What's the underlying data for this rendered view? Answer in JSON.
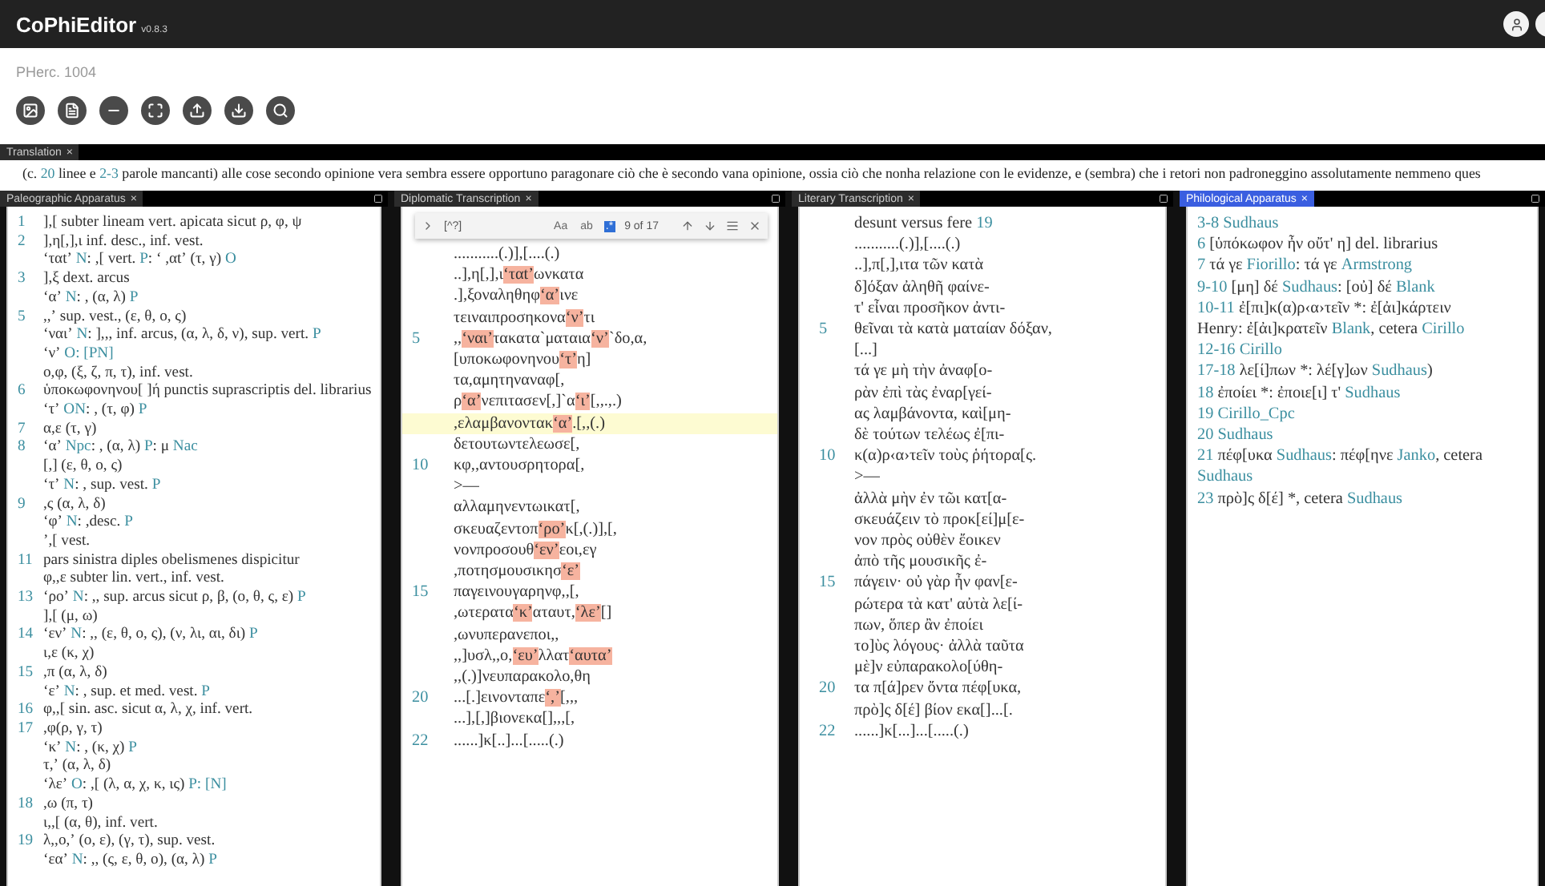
{
  "app": {
    "title": "CoPhiEditor",
    "version": "v0.8.3"
  },
  "document": {
    "title": "PHerc. 1004"
  },
  "toolbar": [
    {
      "kind": "image"
    },
    {
      "kind": "document"
    },
    {
      "kind": "minus"
    },
    {
      "kind": "expand"
    },
    {
      "kind": "upload"
    },
    {
      "kind": "download"
    },
    {
      "kind": "search"
    }
  ],
  "translation": {
    "tab": "Translation",
    "close": "×",
    "parts": [
      {
        "text": "(c. ",
        "kind": "plain"
      },
      {
        "text": "20",
        "kind": "siglum"
      },
      {
        "text": " linee e ",
        "kind": "plain"
      },
      {
        "text": "2-3",
        "kind": "siglum"
      },
      {
        "text": " parole mancanti) alle cose secondo opinione vera sembra essere opportuno paragonare ciò che è secondo vana opinione, ossia ciò che nonha relazione con le evidenze, e (sembra) che i retori non padroneggino assolutamente nemmeno ques",
        "kind": "plain"
      }
    ]
  },
  "panels": [
    {
      "kind": "apparatus",
      "tab": "Paleographic Apparatus",
      "close": "×",
      "selected": false,
      "lines": [
        {
          "num": "1",
          "text": "],[ subter lineam vert. apicata sicut ρ, φ, ψ"
        },
        {
          "num": "2",
          "text": "],η[,],ι inf. desc., inf. vest."
        },
        {
          "parts": [
            {
              "text": "ʻταtʼ ",
              "kind": "plain"
            },
            {
              "text": "N",
              "kind": "siglum"
            },
            {
              "text": ": ,[ vert. ",
              "kind": "plain"
            },
            {
              "text": "P",
              "kind": "siglum"
            },
            {
              "text": ": ʻ ,αtʼ (τ, γ) ",
              "kind": "plain"
            },
            {
              "text": "O",
              "kind": "siglum"
            }
          ]
        },
        {
          "num": "3",
          "text": "],ξ dext. arcus"
        },
        {
          "parts": [
            {
              "text": "ʻαʼ ",
              "kind": "plain"
            },
            {
              "text": "N",
              "kind": "siglum"
            },
            {
              "text": ": , (α, λ) ",
              "kind": "plain"
            },
            {
              "text": "P",
              "kind": "siglum"
            }
          ]
        },
        {
          "num": "5",
          "text": ",,ʼ sup. vest., (ε, θ, ο, ς)"
        },
        {
          "parts": [
            {
              "text": "ʻναιʼ ",
              "kind": "plain"
            },
            {
              "text": "N",
              "kind": "siglum"
            },
            {
              "text": ": ],,, inf. arcus, (α, λ, δ, ν), sup. vert. ",
              "kind": "plain"
            },
            {
              "text": "P",
              "kind": "siglum"
            }
          ]
        },
        {
          "parts": [
            {
              "text": "ʻνʼ ",
              "kind": "plain"
            },
            {
              "text": "O: [PN]",
              "kind": "siglum"
            }
          ]
        },
        {
          "text": "ο,φ, (ξ, ζ, π, τ), inf. vest."
        },
        {
          "num": "6",
          "text": "ὑποκωφονηνου[ ]ή punctis suprascriptis del. librarius"
        },
        {
          "parts": [
            {
              "text": "ʻτʼ ",
              "kind": "plain"
            },
            {
              "text": "ON",
              "kind": "siglum"
            },
            {
              "text": ": , (τ, φ) ",
              "kind": "plain"
            },
            {
              "text": "P",
              "kind": "siglum"
            }
          ]
        },
        {
          "num": "7",
          "text": "α,ε (τ, γ)"
        },
        {
          "num": "8",
          "parts": [
            {
              "text": "ʻαʼ ",
              "kind": "plain"
            },
            {
              "text": "Npc",
              "kind": "siglum"
            },
            {
              "text": ": , (α, λ) ",
              "kind": "plain"
            },
            {
              "text": "P",
              "kind": "siglum"
            },
            {
              "text": ": μ ",
              "kind": "plain"
            },
            {
              "text": "Nac",
              "kind": "siglum"
            }
          ]
        },
        {
          "text": "[,] (ε, θ, ο, ς)"
        },
        {
          "parts": [
            {
              "text": "ʻτʼ ",
              "kind": "plain"
            },
            {
              "text": "N",
              "kind": "siglum"
            },
            {
              "text": ": , sup. vest. ",
              "kind": "plain"
            },
            {
              "text": "P",
              "kind": "siglum"
            }
          ]
        },
        {
          "num": "9",
          "text": ",ς (α, λ, δ)"
        },
        {
          "parts": [
            {
              "text": "ʻφʼ ",
              "kind": "plain"
            },
            {
              "text": "N",
              "kind": "siglum"
            },
            {
              "text": ": ,desc. ",
              "kind": "plain"
            },
            {
              "text": "P",
              "kind": "siglum"
            }
          ]
        },
        {
          "text": "ʼ,[ vest."
        },
        {
          "num": "11",
          "text": "pars sinistra diples obelismenes dispicitur"
        },
        {
          "text": "φ,,ε subter lin. vert., inf. vest."
        },
        {
          "num": "13",
          "parts": [
            {
              "text": "ʻροʼ ",
              "kind": "plain"
            },
            {
              "text": "N",
              "kind": "siglum"
            },
            {
              "text": ": ,, sup. arcus sicut ρ, β, (ο, θ, ς, ε) ",
              "kind": "plain"
            },
            {
              "text": "P",
              "kind": "siglum"
            }
          ]
        },
        {
          "text": "],[ (μ, ω)"
        },
        {
          "num": "14",
          "parts": [
            {
              "text": "ʻενʼ ",
              "kind": "plain"
            },
            {
              "text": "N",
              "kind": "siglum"
            },
            {
              "text": ": ,, (ε, θ, ο, ς), (ν, λι, αι, δι) ",
              "kind": "plain"
            },
            {
              "text": "P",
              "kind": "siglum"
            }
          ]
        },
        {
          "text": "ι,ε (κ, χ)"
        },
        {
          "num": "15",
          "text": ",π (α, λ, δ)"
        },
        {
          "parts": [
            {
              "text": "ʻεʼ ",
              "kind": "plain"
            },
            {
              "text": "N",
              "kind": "siglum"
            },
            {
              "text": ": , sup. et med. vest. ",
              "kind": "plain"
            },
            {
              "text": "P",
              "kind": "siglum"
            }
          ]
        },
        {
          "num": "16",
          "text": "φ,,[ sin. asc. sicut α, λ, χ, inf. vert."
        },
        {
          "num": "17",
          "text": ",φ(ρ, γ, τ)"
        },
        {
          "parts": [
            {
              "text": "ʻκʼ ",
              "kind": "plain"
            },
            {
              "text": "N",
              "kind": "siglum"
            },
            {
              "text": ": , (κ, χ) ",
              "kind": "plain"
            },
            {
              "text": "P",
              "kind": "siglum"
            }
          ]
        },
        {
          "text": "τ,ʼ (α, λ, δ)"
        },
        {
          "parts": [
            {
              "text": "ʻλεʼ ",
              "kind": "plain"
            },
            {
              "text": "O",
              "kind": "siglum"
            },
            {
              "text": ": ,[ (λ, α, χ, κ, ις) ",
              "kind": "plain"
            },
            {
              "text": "P: [N]",
              "kind": "siglum"
            }
          ]
        },
        {
          "num": "18",
          "text": ",ω (π, τ)"
        },
        {
          "text": "ι,,[ (α, θ), inf. vert."
        },
        {
          "num": "19",
          "text": "λ,,ο,ʼ (ο, ε), (γ, τ), sup. vest."
        },
        {
          "parts": [
            {
              "text": "ʻεαʼ ",
              "kind": "plain"
            },
            {
              "text": "N",
              "kind": "siglum"
            },
            {
              "text": ": ,, (ς, ε, θ, ο), (α, λ) ",
              "kind": "plain"
            },
            {
              "text": "P",
              "kind": "siglum"
            }
          ]
        }
      ]
    },
    {
      "kind": "diplomatic",
      "tab": "Diplomatic Transcription",
      "close": "×",
      "selected": false,
      "find": {
        "query": "[^?]",
        "options": [
          {
            "label": "Aa",
            "selected": false
          },
          {
            "label": "ab",
            "selected": false
          },
          {
            "label": ".*",
            "selected": true
          }
        ],
        "count": "9 of 17"
      },
      "lines": [
        {
          "current": false,
          "text": "...........(.)],[....(.)"
        },
        {
          "current": false,
          "parts": [
            {
              "text": "..],η[,],ι",
              "kind": "plain"
            },
            {
              "text": "ʻταtʼ",
              "kind": "mark"
            },
            {
              "text": "ωνκατα",
              "kind": "plain"
            }
          ]
        },
        {
          "current": false,
          "parts": [
            {
              "text": ".],ξοναληθηφ",
              "kind": "plain"
            },
            {
              "text": "ʻαʼ",
              "kind": "mark"
            },
            {
              "text": "ινε",
              "kind": "plain"
            }
          ]
        },
        {
          "current": false,
          "parts": [
            {
              "text": "τειναιπροσηκονα",
              "kind": "plain"
            },
            {
              "text": "ʻνʼ",
              "kind": "mark"
            },
            {
              "text": "τι",
              "kind": "plain"
            }
          ]
        },
        {
          "current": false,
          "num": "5",
          "parts": [
            {
              "text": ",,",
              "kind": "plain"
            },
            {
              "text": "ʻναιʼ",
              "kind": "mark"
            },
            {
              "text": "τακατα`ματαια",
              "kind": "plain"
            },
            {
              "text": "ʻνʼ",
              "kind": "mark"
            },
            {
              "text": "`δο,α,",
              "kind": "plain"
            }
          ]
        },
        {
          "current": false,
          "parts": [
            {
              "text": "[υποκωφονηνου",
              "kind": "plain"
            },
            {
              "text": "ʻτʼ",
              "kind": "mark"
            },
            {
              "text": "η]",
              "kind": "plain"
            }
          ]
        },
        {
          "current": false,
          "text": "τα,αμητηναναφ[,"
        },
        {
          "current": false,
          "parts": [
            {
              "text": "ρ",
              "kind": "plain"
            },
            {
              "text": "ʻαʼ",
              "kind": "mark"
            },
            {
              "text": "νεπιτασεν[,]`α",
              "kind": "plain"
            },
            {
              "text": "ʻιʼ",
              "kind": "mark"
            },
            {
              "text": "[,,.,.)",
              "kind": "plain"
            }
          ]
        },
        {
          "current": true,
          "parts": [
            {
              "text": ",ελαμβανοντακ",
              "kind": "plain"
            },
            {
              "text": "ʻαʼ",
              "kind": "mark"
            },
            {
              "text": ".[,,(.)",
              "kind": "plain"
            }
          ]
        },
        {
          "current": false,
          "text": "δετουτωντελεωσε[,"
        },
        {
          "current": false,
          "num": "10",
          "text": "κφ,,αντουσρητορα[,"
        },
        {
          "current": false,
          "text": ">—"
        },
        {
          "current": false,
          "text": "αλλαμηνεντωικατ[,"
        },
        {
          "current": false,
          "parts": [
            {
              "text": "σκευαζεντοπ",
              "kind": "plain"
            },
            {
              "text": "ʻροʼ",
              "kind": "mark"
            },
            {
              "text": "κ[,(.)],[,",
              "kind": "plain"
            }
          ]
        },
        {
          "current": false,
          "parts": [
            {
              "text": "νονπροσουθ",
              "kind": "plain"
            },
            {
              "text": "ʻενʼ",
              "kind": "mark"
            },
            {
              "text": "εοι,εγ",
              "kind": "plain"
            }
          ]
        },
        {
          "current": false,
          "parts": [
            {
              "text": ",ποτησμουσικησ",
              "kind": "plain"
            },
            {
              "text": "ʻεʼ",
              "kind": "mark"
            }
          ]
        },
        {
          "current": false,
          "num": "15",
          "text": "παγεινουγαρηνφ,,[,"
        },
        {
          "current": false,
          "parts": [
            {
              "text": ",ωτερατα",
              "kind": "plain"
            },
            {
              "text": "ʻκʼ",
              "kind": "mark"
            },
            {
              "text": "αταυτ,",
              "kind": "plain"
            },
            {
              "text": "ʻλεʼ",
              "kind": "mark"
            },
            {
              "text": "[]",
              "kind": "plain"
            }
          ]
        },
        {
          "current": false,
          "text": ",ωνυπερανεποι,,"
        },
        {
          "current": false,
          "parts": [
            {
              "text": ",,]υσλ,,ο,",
              "kind": "plain"
            },
            {
              "text": "ʻευʼ",
              "kind": "mark"
            },
            {
              "text": "λλατ",
              "kind": "plain"
            },
            {
              "text": "ʻαυταʼ",
              "kind": "mark"
            }
          ]
        },
        {
          "current": false,
          "text": ",,(.)]νευπαρακολο,θη"
        },
        {
          "current": false,
          "num": "20",
          "parts": [
            {
              "text": "...[.]εινονταπε",
              "kind": "plain"
            },
            {
              "text": "ʻ,ʼ",
              "kind": "mark"
            },
            {
              "text": "[,,,",
              "kind": "plain"
            }
          ]
        },
        {
          "current": false,
          "text": "...],[,]βιονεκα[],,,[,"
        },
        {
          "current": false,
          "num": "22",
          "text": "......]κ[..]...[.....(.)"
        }
      ]
    },
    {
      "kind": "literary",
      "tab": "Literary Transcription",
      "close": "×",
      "selected": false,
      "lines": [
        {
          "parts": [
            {
              "text": "desunt versus fere ",
              "kind": "plain"
            },
            {
              "text": "19",
              "kind": "siglum"
            }
          ]
        },
        {
          "text": "...........(.)],[....(.)"
        },
        {
          "text": "..],π[,],ιτα τῶν κατὰ"
        },
        {
          "text": "δ]όξαν ἀληθῆ φαίνε-"
        },
        {
          "text": "τ' εἶναι προσῆκον ἀντι-"
        },
        {
          "num": "5",
          "text": "θεῖναι τὰ κατὰ ματαίαν δόξαν,"
        },
        {
          "text": "[...]"
        },
        {
          "text": "τά γε μὴ τὴν ἀναφ[ο-"
        },
        {
          "text": "ρὰν ἐπὶ τὰς ἐναρ[γεί-"
        },
        {
          "text": "ας λαμβάνοντα, καὶ[μη-"
        },
        {
          "text": "δὲ τούτων τελέως ἐ[πι-"
        },
        {
          "num": "10",
          "text": "κ(α)ρ‹α›τεῖν τοὺς ῥήτορα[ς."
        },
        {
          "text": ">—"
        },
        {
          "text": "ἀλλὰ μὴν ἐν τῶι κατ[α-"
        },
        {
          "text": "σκευάζειν τὸ προκ[εί]μ[ε-"
        },
        {
          "text": "νον πρὸς οὐθὲν ἔοικεν"
        },
        {
          "text": "ἀπὸ τῆς μουσικῆς ἐ-"
        },
        {
          "num": "15",
          "text": "πάγειν· οὐ γὰρ ἦν φαν[ε-"
        },
        {
          "text": "ρώτερα τὰ κατ' αὐτὰ λε[ί-"
        },
        {
          "text": "πων, ὅπερ ἂν ἐποίει"
        },
        {
          "text": "το]ὺς λόγους· ἀλλὰ ταῦτα"
        },
        {
          "text": "μὲ]ν εὐπαρακολο[ύθη-"
        },
        {
          "num": "20",
          "text": "τα π[ά]ρεν ὄντα πέφ[υκα,"
        },
        {
          "text": "πρὸ]ς δ[έ] βίον εκα[]...[."
        },
        {
          "num": "22",
          "text": "......]κ[...]...[.....(.)"
        }
      ]
    },
    {
      "kind": "philological",
      "tab": "Philological Apparatus",
      "close": "×",
      "selected": true,
      "lines": [
        {
          "parts": [
            {
              "text": "3-8 Sudhaus",
              "kind": "siglum"
            }
          ]
        },
        {
          "parts": [
            {
              "text": "6 ",
              "kind": "siglum"
            },
            {
              "text": "[ὑπόκωφον ἦν οὔτ' η] del. librarius",
              "kind": "plain"
            }
          ]
        },
        {
          "parts": [
            {
              "text": "7 ",
              "kind": "siglum"
            },
            {
              "text": "τά γε ",
              "kind": "plain"
            },
            {
              "text": "Fiorillo",
              "kind": "siglum"
            },
            {
              "text": ": τά γε ",
              "kind": "plain"
            },
            {
              "text": "Armstrong",
              "kind": "siglum"
            }
          ]
        },
        {
          "parts": [
            {
              "text": "9-10 ",
              "kind": "siglum"
            },
            {
              "text": "[μη] δέ ",
              "kind": "plain"
            },
            {
              "text": "Sudhaus",
              "kind": "siglum"
            },
            {
              "text": ": [οὐ] δέ ",
              "kind": "plain"
            },
            {
              "text": "Blank",
              "kind": "siglum"
            }
          ]
        },
        {
          "parts": [
            {
              "text": "10-11 ",
              "kind": "siglum"
            },
            {
              "text": "ἐ[πι]κ(α)ρ‹α›τεῖν *: ἐ[ἀι]κάρτειν",
              "kind": "plain"
            }
          ]
        },
        {
          "parts": [
            {
              "text": "Henry: ἐ[ἀι]κρατεῖν ",
              "kind": "plain"
            },
            {
              "text": "Blank",
              "kind": "siglum"
            },
            {
              "text": ", cetera ",
              "kind": "plain"
            },
            {
              "text": "Cirillo",
              "kind": "siglum"
            }
          ]
        },
        {
          "parts": [
            {
              "text": "12-16 Cirillo",
              "kind": "siglum"
            }
          ]
        },
        {
          "parts": [
            {
              "text": "17-18 ",
              "kind": "siglum"
            },
            {
              "text": "λε[ί]πων *: λέ[γ]ων ",
              "kind": "plain"
            },
            {
              "text": "Sudhaus",
              "kind": "siglum"
            },
            {
              "text": ")",
              "kind": "plain"
            }
          ]
        },
        {
          "parts": [
            {
              "text": "18 ",
              "kind": "siglum"
            },
            {
              "text": "ἐποίει *: ἐποιε[ι] τ' ",
              "kind": "plain"
            },
            {
              "text": "Sudhaus",
              "kind": "siglum"
            }
          ]
        },
        {
          "parts": [
            {
              "text": "19 Cirillo_Cpc",
              "kind": "siglum"
            }
          ]
        },
        {
          "parts": [
            {
              "text": "20 Sudhaus",
              "kind": "siglum"
            }
          ]
        },
        {
          "parts": [
            {
              "text": "21 ",
              "kind": "siglum"
            },
            {
              "text": "πέφ[υκα ",
              "kind": "plain"
            },
            {
              "text": "Sudhaus",
              "kind": "siglum"
            },
            {
              "text": ": πέφ[ηνε ",
              "kind": "plain"
            },
            {
              "text": "Janko",
              "kind": "siglum"
            },
            {
              "text": ", cetera",
              "kind": "plain"
            }
          ]
        },
        {
          "parts": [
            {
              "text": "Sudhaus",
              "kind": "siglum"
            }
          ]
        },
        {
          "parts": [
            {
              "text": "23 ",
              "kind": "siglum"
            },
            {
              "text": "πρὸ]ς δ[έ] *, cetera ",
              "kind": "plain"
            },
            {
              "text": "Sudhaus",
              "kind": "siglum"
            }
          ]
        }
      ]
    }
  ]
}
